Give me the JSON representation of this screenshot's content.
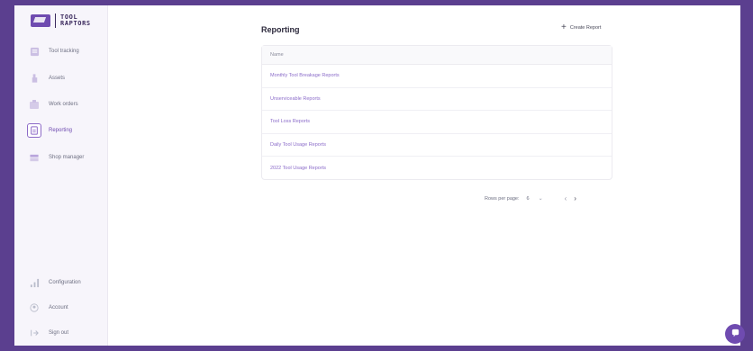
{
  "logo": {
    "line1": "TOOL",
    "line2": "RAPTORS"
  },
  "sidebar": {
    "items": [
      {
        "label": "Tool tracking",
        "icon": "tool-tracking-icon"
      },
      {
        "label": "Assets",
        "icon": "assets-icon"
      },
      {
        "label": "Work orders",
        "icon": "work-orders-icon"
      },
      {
        "label": "Reporting",
        "icon": "reporting-icon",
        "active": true
      },
      {
        "label": "Shop manager",
        "icon": "shop-manager-icon"
      }
    ],
    "bottom_items": [
      {
        "label": "Configuration",
        "icon": "configuration-icon"
      },
      {
        "label": "Account",
        "icon": "account-icon"
      },
      {
        "label": "Sign out",
        "icon": "sign-out-icon"
      }
    ]
  },
  "page": {
    "title": "Reporting",
    "create_label": "Create Report"
  },
  "table": {
    "column_header": "Name",
    "rows": [
      "Monthly Tool Breakage Reports",
      "Unserviceable Reports",
      "Tool Loss Reports",
      "Daily Tool Usage Reports",
      "2022 Tool Usage Reports"
    ]
  },
  "pagination": {
    "rows_per_page_label": "Rows per page:",
    "rows_per_page_value": "6",
    "range": "",
    "caret": "⌄",
    "prev": "‹",
    "next": "›"
  },
  "colors": {
    "accent": "#6f4bb0",
    "link": "#8b6cc9",
    "frame_bg": "#5b3f8f",
    "sidebar_bg": "#f7f5fb"
  }
}
